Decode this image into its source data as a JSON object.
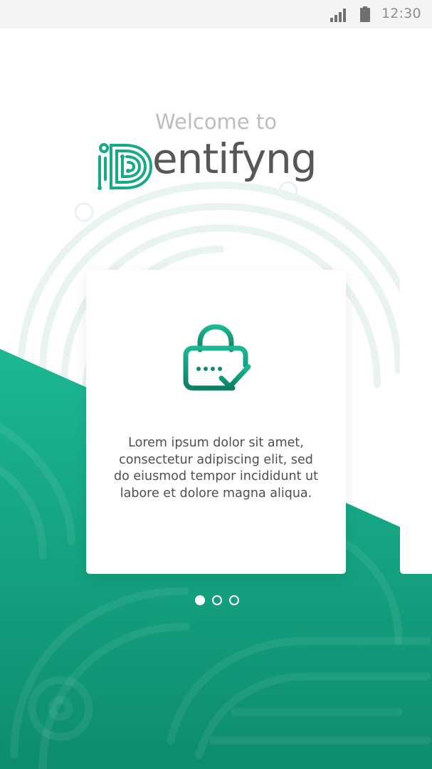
{
  "status_bar": {
    "time": "12:30",
    "signal_icon": "cellular-signal-icon",
    "battery_icon": "battery-icon"
  },
  "welcome": {
    "intro": "Welcome to",
    "brand_prefix": "iD",
    "brand_suffix": "entifyng"
  },
  "carousel": {
    "slides": [
      {
        "icon": "lock-check-icon",
        "text": "Lorem ipsum dolor sit amet, consectetur adipiscing elit, sed do eiusmod tempor incididunt ut labore et dolore magna aliqua."
      }
    ],
    "page_count": 3,
    "active_index": 0
  },
  "colors": {
    "brand_green": "#17a988",
    "brand_green_dark": "#0f8a70",
    "text_gray": "#575757",
    "muted_gray": "#bdbdbd"
  }
}
